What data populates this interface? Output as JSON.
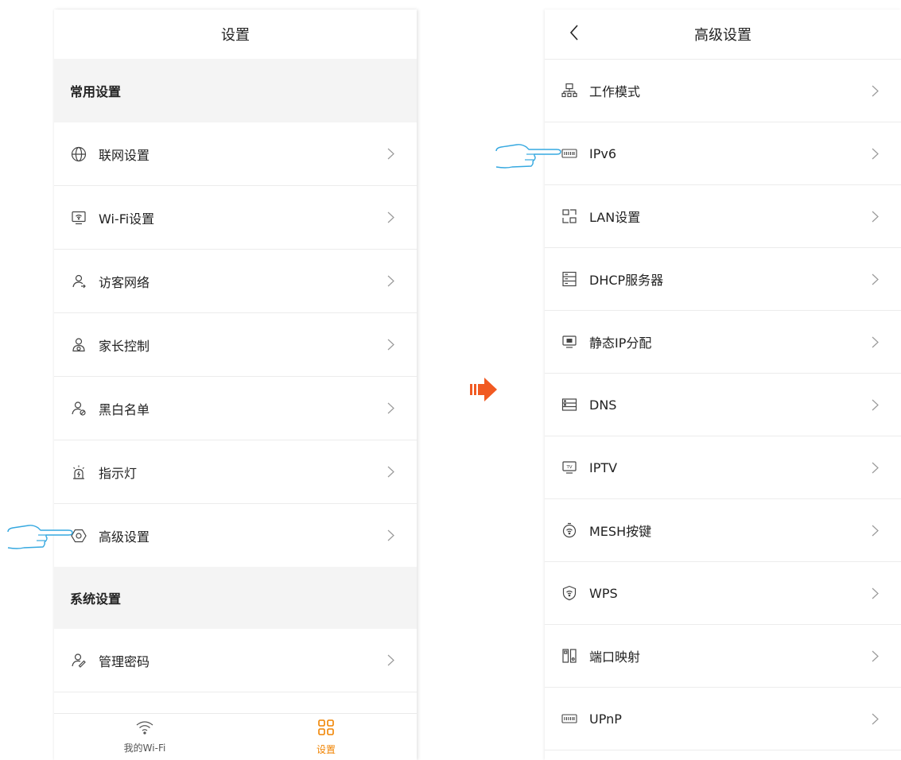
{
  "left": {
    "title": "设置",
    "common_section": "常用设置",
    "common_items": [
      {
        "label": "联网设置",
        "icon": "globe-icon"
      },
      {
        "label": "Wi-Fi设置",
        "icon": "wifi-monitor-icon"
      },
      {
        "label": "访客网络",
        "icon": "guest-user-icon"
      },
      {
        "label": "家长控制",
        "icon": "parental-control-icon"
      },
      {
        "label": "黑白名单",
        "icon": "blocklist-user-icon"
      },
      {
        "label": "指示灯",
        "icon": "indicator-light-icon"
      },
      {
        "label": "高级设置",
        "icon": "hexagon-settings-icon"
      }
    ],
    "system_section": "系统设置",
    "system_items": [
      {
        "label": "管理密码",
        "icon": "admin-password-icon"
      }
    ],
    "tabs": [
      {
        "label": "我的Wi-Fi",
        "icon": "wifi-icon",
        "color": "#555555"
      },
      {
        "label": "设置",
        "icon": "grid-icon",
        "color": "#f08300"
      }
    ]
  },
  "right": {
    "title": "高级设置",
    "items": [
      {
        "label": "工作模式",
        "icon": "network-topology-icon"
      },
      {
        "label": "IPv6",
        "icon": "ipv6-icon"
      },
      {
        "label": "LAN设置",
        "icon": "lan-icon"
      },
      {
        "label": "DHCP服务器",
        "icon": "server-list-icon"
      },
      {
        "label": "静态IP分配",
        "icon": "static-ip-icon"
      },
      {
        "label": "DNS",
        "icon": "dns-icon"
      },
      {
        "label": "IPTV",
        "icon": "tv-icon"
      },
      {
        "label": "MESH按键",
        "icon": "mesh-button-icon"
      },
      {
        "label": "WPS",
        "icon": "wps-shield-icon"
      },
      {
        "label": "端口映射",
        "icon": "port-mapping-icon"
      },
      {
        "label": "UPnP",
        "icon": "upnp-icon"
      }
    ]
  },
  "colors": {
    "accent": "#f08300",
    "arrow": "#f15a22",
    "pointer": "#35a8e0"
  }
}
